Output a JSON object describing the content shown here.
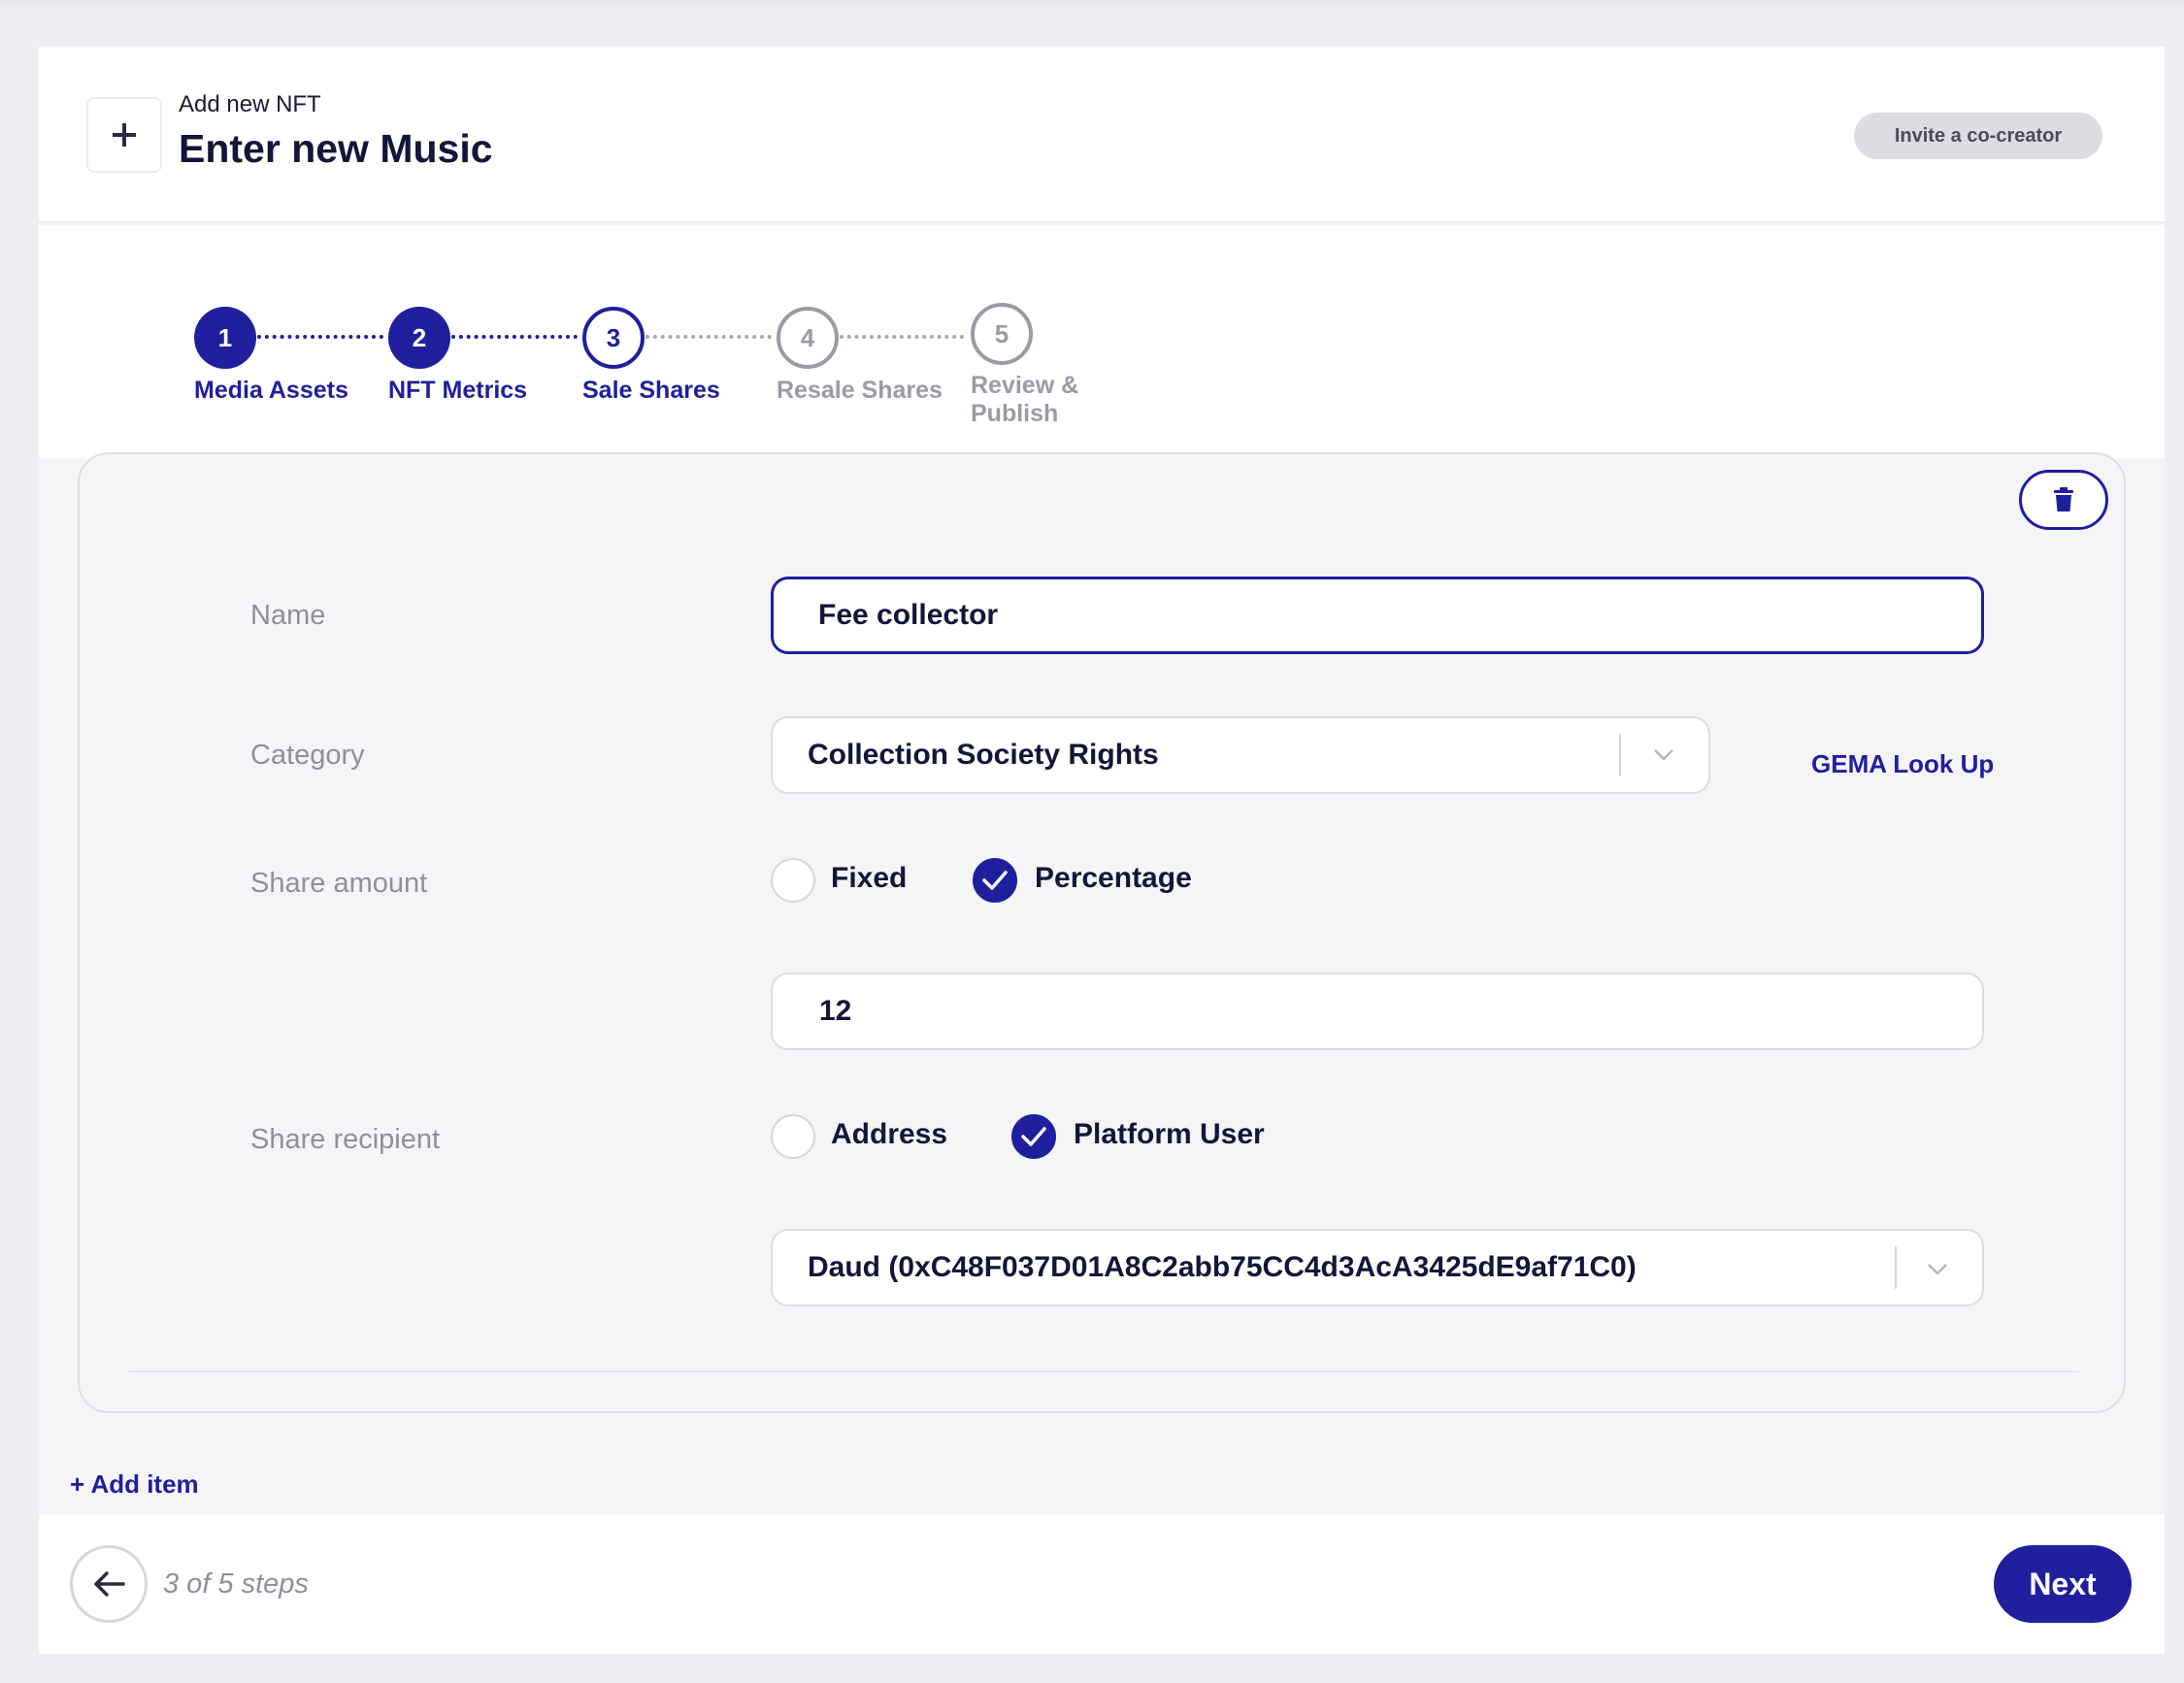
{
  "header": {
    "subtitle": "Add new NFT",
    "title": "Enter new Music",
    "invite_label": "Invite a co-creator",
    "plus_icon": "plus-icon"
  },
  "stepper": {
    "steps": [
      {
        "number": "1",
        "label": "Media Assets",
        "state": "done"
      },
      {
        "number": "2",
        "label": "NFT Metrics",
        "state": "done"
      },
      {
        "number": "3",
        "label": "Sale Shares",
        "state": "active"
      },
      {
        "number": "4",
        "label": "Resale Shares",
        "state": "todo"
      },
      {
        "number": "5",
        "label_line1": "Review &",
        "label_line2": "Publish",
        "state": "todo"
      }
    ]
  },
  "form": {
    "name_label": "Name",
    "name_value": "Fee collector",
    "category_label": "Category",
    "category_value": "Collection Society Rights",
    "gema_link": "GEMA Look Up",
    "share_amount_label": "Share amount",
    "share_amount_options": [
      {
        "label": "Fixed",
        "checked": false
      },
      {
        "label": "Percentage",
        "checked": true
      }
    ],
    "share_amount_value": "12",
    "share_recipient_label": "Share recipient",
    "share_recipient_options": [
      {
        "label": "Address",
        "checked": false
      },
      {
        "label": "Platform User",
        "checked": true
      }
    ],
    "recipient_value": "Daud (0xC48F037D01A8C2abb75CC4d3AcA3425dE9af71C0)"
  },
  "add_item_label": "+ Add item",
  "footer": {
    "step_count": "3 of 5 steps",
    "next_label": "Next"
  },
  "colors": {
    "accent": "#1f1f9e",
    "muted": "#9b9ba6",
    "background": "#efeff3"
  }
}
